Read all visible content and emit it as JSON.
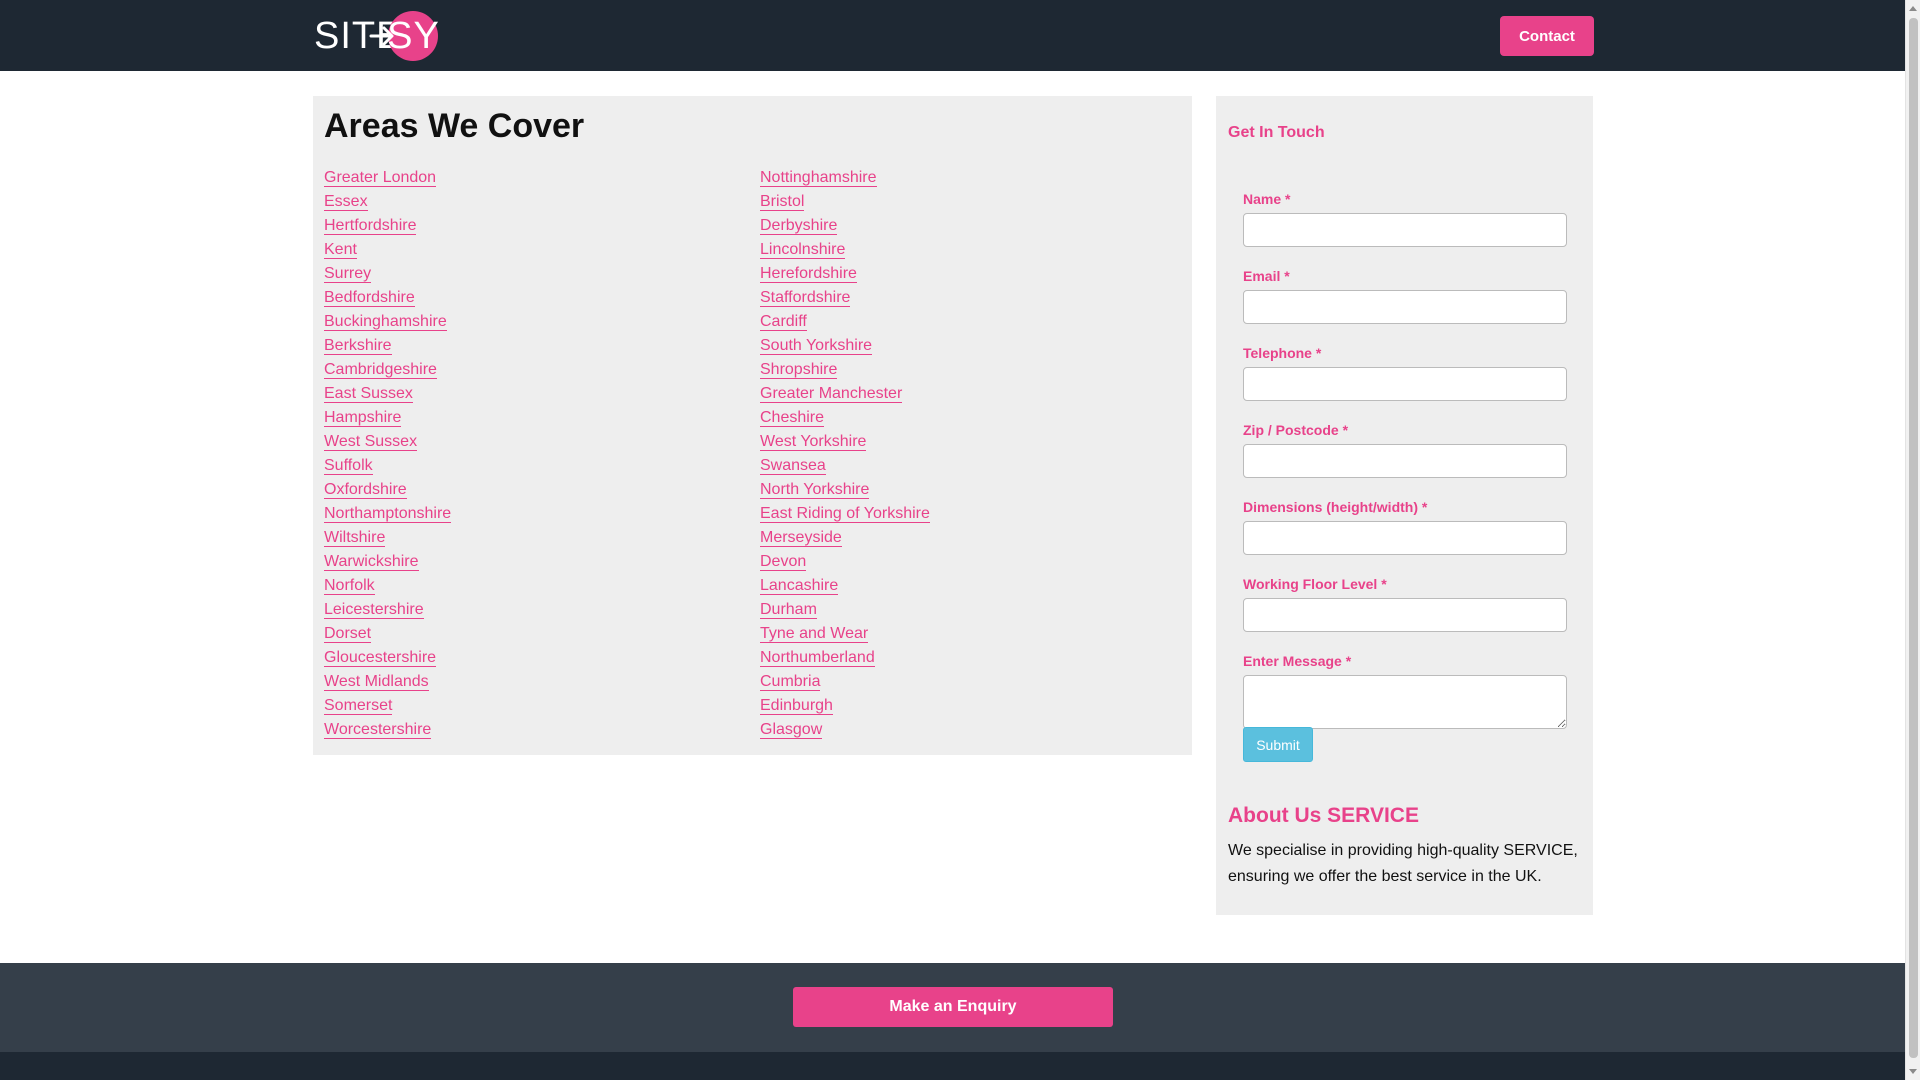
{
  "navbar": {
    "logo_text_left": "SITE",
    "logo_text_right": "SY",
    "contact_label": "Contact"
  },
  "areas": {
    "title": "Areas We Cover",
    "left_column": [
      "Greater London",
      "Essex",
      "Hertfordshire",
      "Kent",
      "Surrey",
      "Bedfordshire",
      "Buckinghamshire",
      "Berkshire",
      "Cambridgeshire",
      "East Sussex",
      "Hampshire",
      "West Sussex",
      "Suffolk",
      "Oxfordshire",
      "Northamptonshire",
      "Wiltshire",
      "Warwickshire",
      "Norfolk",
      "Leicestershire",
      "Dorset",
      "Gloucestershire",
      "West Midlands",
      "Somerset",
      "Worcestershire"
    ],
    "right_column": [
      "Nottinghamshire",
      "Bristol",
      "Derbyshire",
      "Lincolnshire",
      "Herefordshire",
      "Staffordshire",
      "Cardiff",
      "South Yorkshire",
      "Shropshire",
      "Greater Manchester",
      "Cheshire",
      "West Yorkshire",
      "Swansea",
      "North Yorkshire",
      "East Riding of Yorkshire",
      "Merseyside",
      "Devon",
      "Lancashire",
      "Durham",
      "Tyne and Wear",
      "Northumberland",
      "Cumbria",
      "Edinburgh",
      "Glasgow"
    ]
  },
  "sidebar": {
    "title": "Get In Touch",
    "fields": [
      {
        "label": "Name *",
        "type": "input",
        "value": ""
      },
      {
        "label": "Email *",
        "type": "input",
        "value": ""
      },
      {
        "label": "Telephone *",
        "type": "input",
        "value": ""
      },
      {
        "label": "Zip / Postcode *",
        "type": "input",
        "value": ""
      },
      {
        "label": "Dimensions (height/width) *",
        "type": "input",
        "value": ""
      },
      {
        "label": "Working Floor Level *",
        "type": "input",
        "value": ""
      },
      {
        "label": "Enter Message *",
        "type": "textarea",
        "value": ""
      }
    ],
    "submit_label": "Submit",
    "about_title": "About Us SERVICE",
    "about_text": "We specialise in providing high-quality SERVICE, ensuring we offer the best service in the UK."
  },
  "footer": {
    "enquiry_label": "Make an Enquiry"
  },
  "colors": {
    "accent": "#e8428a",
    "navbar": "#1e2833",
    "band": "#353f4a",
    "panel": "#eeeeee",
    "submit": "#5bc0de"
  }
}
